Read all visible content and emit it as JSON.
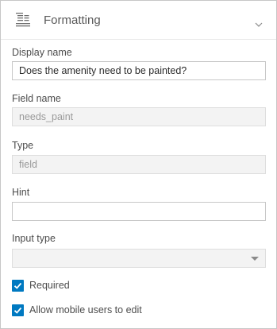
{
  "header": {
    "title": "Formatting",
    "icon": "formatting-icon",
    "collapse_icon": "chevron-down-icon"
  },
  "form": {
    "display_name": {
      "label": "Display name",
      "value": "Does the amenity need to be painted?"
    },
    "field_name": {
      "label": "Field name",
      "value": "needs_paint"
    },
    "type": {
      "label": "Type",
      "value": "field"
    },
    "hint": {
      "label": "Hint",
      "value": ""
    },
    "input_type": {
      "label": "Input type",
      "value": ""
    },
    "required": {
      "label": "Required",
      "checked": true
    },
    "allow_mobile_edit": {
      "label": "Allow mobile users to edit",
      "checked": true
    }
  },
  "colors": {
    "accent": "#0079c1",
    "border": "#c7c7c7",
    "disabled_bg": "#f3f3f3",
    "text": "#4c4c4c"
  }
}
